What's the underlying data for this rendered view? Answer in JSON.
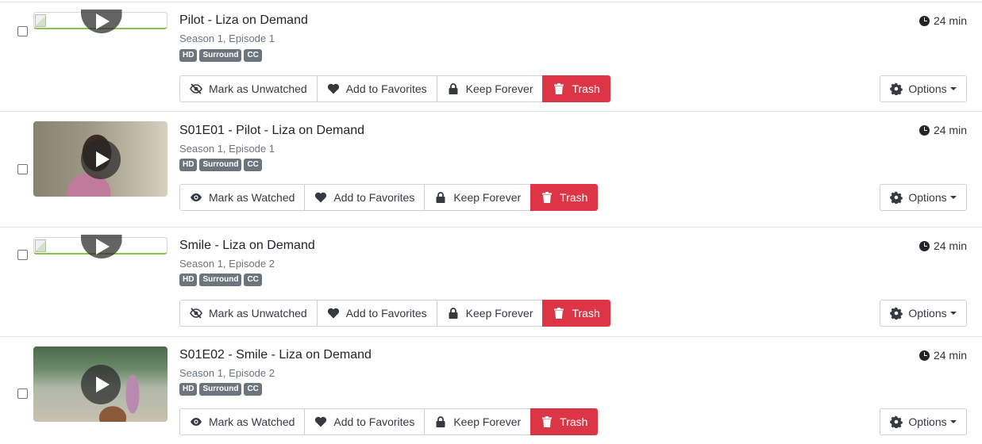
{
  "episodes": [
    {
      "title": "Pilot - Liza on Demand",
      "subtitle": "Season 1, Episode 1",
      "badges": [
        "HD",
        "Surround",
        "CC"
      ],
      "duration": "24 min",
      "watch_label": "Mark as Unwatched",
      "favorites_label": "Add to Favorites",
      "keep_label": "Keep Forever",
      "trash_label": "Trash",
      "options_label": "Options",
      "thumbnail": "broken"
    },
    {
      "title": "S01E01 - Pilot - Liza on Demand",
      "subtitle": "Season 1, Episode 1",
      "badges": [
        "HD",
        "Surround",
        "CC"
      ],
      "duration": "24 min",
      "watch_label": "Mark as Watched",
      "favorites_label": "Add to Favorites",
      "keep_label": "Keep Forever",
      "trash_label": "Trash",
      "options_label": "Options",
      "thumbnail": "image"
    },
    {
      "title": "Smile - Liza on Demand",
      "subtitle": "Season 1, Episode 2",
      "badges": [
        "HD",
        "Surround",
        "CC"
      ],
      "duration": "24 min",
      "watch_label": "Mark as Unwatched",
      "favorites_label": "Add to Favorites",
      "keep_label": "Keep Forever",
      "trash_label": "Trash",
      "options_label": "Options",
      "thumbnail": "broken"
    },
    {
      "title": "S01E02 - Smile - Liza on Demand",
      "subtitle": "Season 1, Episode 2",
      "badges": [
        "HD",
        "Surround",
        "CC"
      ],
      "duration": "24 min",
      "watch_label": "Mark as Watched",
      "favorites_label": "Add to Favorites",
      "keep_label": "Keep Forever",
      "trash_label": "Trash",
      "options_label": "Options",
      "thumbnail": "image"
    }
  ],
  "colors": {
    "trash": "#dc3545",
    "badge": "#6c757d",
    "border": "#cdd1d5"
  },
  "icons": {
    "watched": "eye-icon",
    "unwatched": "eye-slash-icon",
    "favorites": "heart-icon",
    "keep": "lock-icon",
    "trash": "trash-icon",
    "options": "gear-icon",
    "duration": "clock-icon"
  }
}
